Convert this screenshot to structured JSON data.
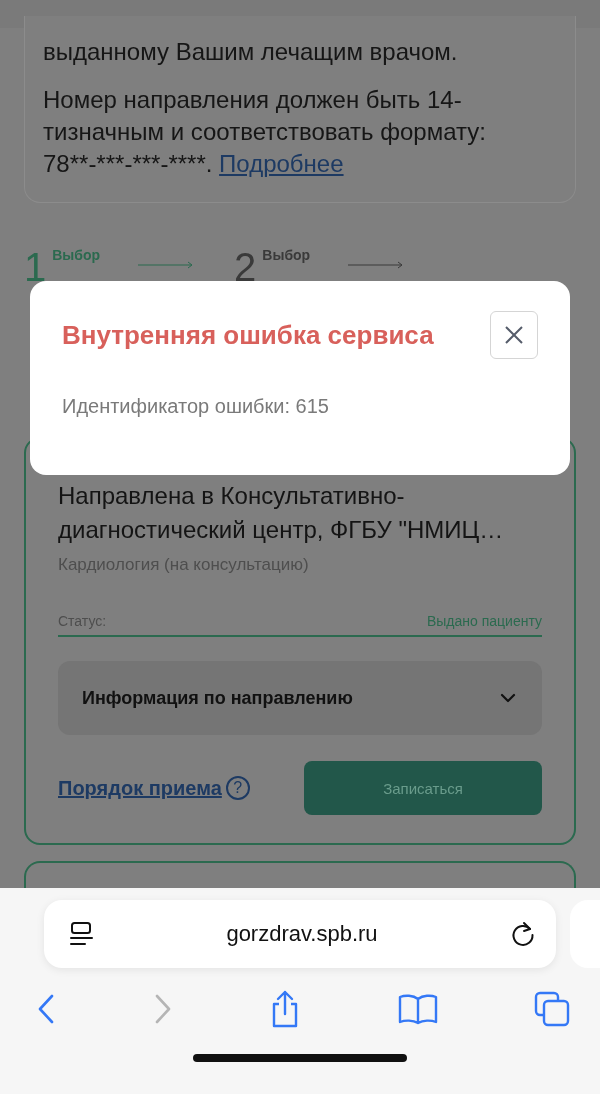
{
  "info_card": {
    "first_line": "выданному Вашим лечащим врачом.",
    "paragraph": "Номер направления должен быть 14-тизначным и соответствовать формату: 78**-***-***-****.",
    "link": "Подробнее"
  },
  "steps": [
    {
      "number": "1",
      "label": "Выбор",
      "selected": true
    },
    {
      "number": "2",
      "label": "Выбор",
      "selected": false
    }
  ],
  "referral": {
    "title": "Направлена в Консультативно-диагностический центр, ФГБУ \"НМИЦ…",
    "subtitle": "Кардиология (на консультацию)",
    "status_label": "Статус:",
    "status_value": "Выдано пациенту",
    "accordion": {
      "label": "Информация по направлению",
      "expanded": false
    },
    "rules_link": "Порядок приема",
    "help_icon": "?",
    "book_button": "Записаться"
  },
  "dialog": {
    "title": "Внутренняя ошибка сервиса",
    "message": "Идентификатор ошибки: 615"
  },
  "browser": {
    "url": "gorzdrav.spb.ru",
    "back_disabled": false,
    "forward_disabled": true
  }
}
